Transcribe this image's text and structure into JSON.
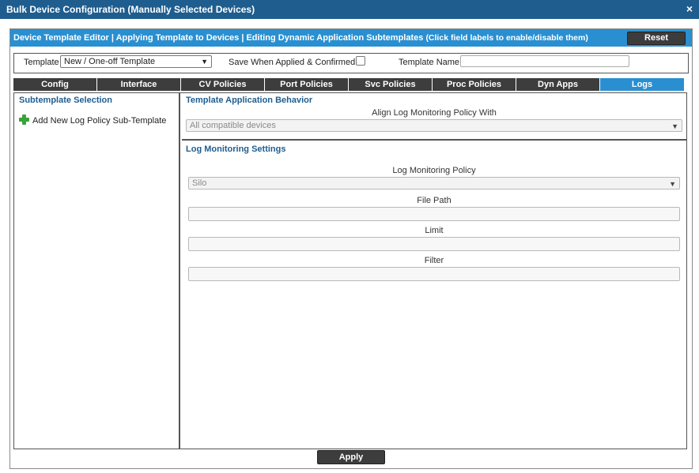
{
  "window": {
    "title": "Bulk Device Configuration (Manually Selected Devices)",
    "close_icon": "×"
  },
  "editor": {
    "header_title": "Device Template Editor | Applying Template to Devices | Editing Dynamic Application Subtemplates",
    "header_hint": "(Click field labels to enable/disable them)",
    "reset_label": "Reset"
  },
  "template_bar": {
    "template_label": "Template",
    "template_value": "New / One-off Template",
    "save_label": "Save When Applied & Confirmed",
    "name_label": "Template Name",
    "name_value": ""
  },
  "tabs": [
    {
      "label": "Config",
      "active": false
    },
    {
      "label": "Interface",
      "active": false
    },
    {
      "label": "CV Policies",
      "active": false
    },
    {
      "label": "Port Policies",
      "active": false
    },
    {
      "label": "Svc Policies",
      "active": false
    },
    {
      "label": "Proc Policies",
      "active": false
    },
    {
      "label": "Dyn Apps",
      "active": false
    },
    {
      "label": "Logs",
      "active": true
    }
  ],
  "left_pane": {
    "title": "Subtemplate Selection",
    "add_label": "Add New Log Policy Sub-Template",
    "add_icon": "plus-icon"
  },
  "behavior": {
    "title": "Template Application Behavior",
    "align_label": "Align Log Monitoring Policy With",
    "align_value": "All compatible devices"
  },
  "settings": {
    "title": "Log Monitoring Settings",
    "policy_label": "Log Monitoring Policy",
    "policy_value": "Silo",
    "file_path_label": "File Path",
    "file_path_value": "",
    "limit_label": "Limit",
    "limit_value": "",
    "filter_label": "Filter",
    "filter_value": ""
  },
  "footer": {
    "apply_label": "Apply"
  },
  "colors": {
    "title_bar": "#1f5d8f",
    "header_blue": "#2a8fd0",
    "tab_dark": "#3d3d3d",
    "section_title": "#1f5d8f",
    "add_icon_green": "#3aa33a"
  }
}
